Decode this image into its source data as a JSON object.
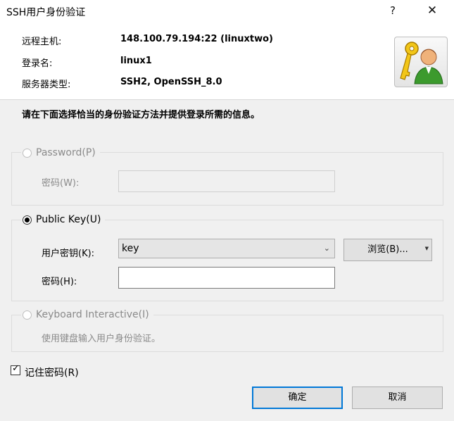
{
  "window": {
    "title": "SSH用户身份验证",
    "help_label": "?",
    "close_label": "✕"
  },
  "info": {
    "host_label": "远程主机:",
    "host_value": "148.100.79.194:22 (linuxtwo)",
    "login_label": "登录名:",
    "login_value": "linux1",
    "server_label": "服务器类型:",
    "server_value": "SSH2, OpenSSH_8.0",
    "icon": "user-key-icon"
  },
  "instruction": "请在下面选择恰当的身份验证方法并提供登录所需的信息。",
  "password_group": {
    "label": "Password(P)",
    "selected": false,
    "enabled": false,
    "field_label": "密码(W):",
    "field_value": ""
  },
  "publickey_group": {
    "label": "Public Key(U)",
    "selected": true,
    "key_label": "用户密钥(K):",
    "key_value": "key",
    "browse_label": "浏览(B)...",
    "passphrase_label": "密码(H):",
    "passphrase_value": ""
  },
  "keyboard_group": {
    "label": "Keyboard Interactive(I)",
    "selected": false,
    "enabled": false,
    "description": "使用键盘输入用户身份验证。"
  },
  "remember": {
    "label": "记住密码(R)",
    "checked": true
  },
  "buttons": {
    "ok_label": "确定",
    "cancel_label": "取消"
  },
  "colors": {
    "accent": "#0078d7",
    "panel_bg": "#f0f0f0"
  }
}
